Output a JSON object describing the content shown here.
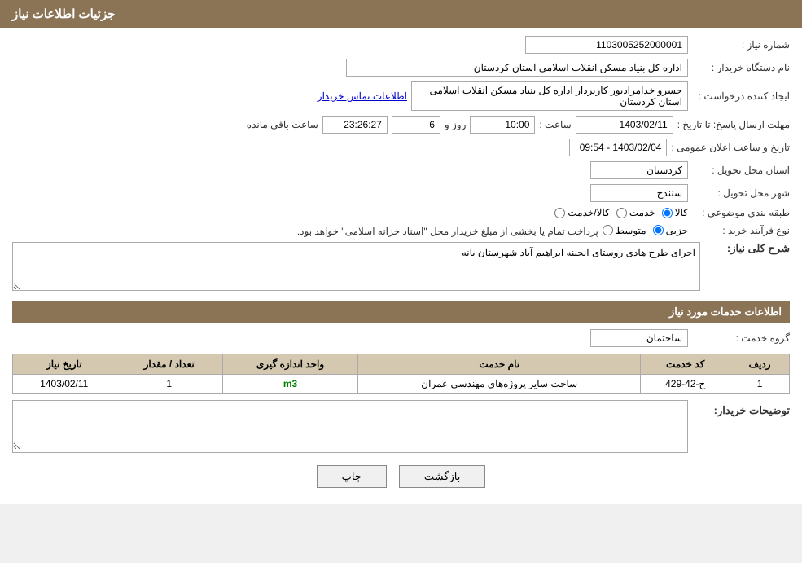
{
  "page": {
    "title": "جزئیات اطلاعات نیاز",
    "header": "جزئیات اطلاعات نیاز"
  },
  "fields": {
    "need_number_label": "شماره نیاز :",
    "need_number_value": "1103005252000001",
    "buyer_org_label": "نام دستگاه خریدار :",
    "buyer_org_value": "اداره کل بنیاد مسکن انقلاب اسلامی استان کردستان",
    "creator_label": "ایجاد کننده درخواست :",
    "creator_value": "جسرو خدامرادیور کاربردار اداره کل بنیاد مسکن انقلاب اسلامی استان کردستان",
    "creator_link": "اطلاعات تماس خریدار",
    "deadline_label": "مهلت ارسال پاسخ: تا تاریخ :",
    "date_value": "1403/02/11",
    "time_label": "ساعت :",
    "time_value": "10:00",
    "day_label": "روز و",
    "day_value": "6",
    "remaining_label": "ساعت باقی مانده",
    "remaining_value": "23:26:27",
    "announce_label": "تاریخ و ساعت اعلان عمومی :",
    "announce_value": "1403/02/04 - 09:54",
    "province_label": "استان محل تحویل :",
    "province_value": "کردستان",
    "city_label": "شهر محل تحویل :",
    "city_value": "سنندج",
    "category_label": "طبقه بندی موضوعی :",
    "radio_kala": "کالا",
    "radio_khadamat": "خدمت",
    "radio_kala_khadamat": "کالا/خدمت",
    "process_label": "نوع فرآیند خرید :",
    "radio_jozvi": "جزیی",
    "radio_motovaset": "متوسط",
    "payment_text": "پرداخت تمام یا بخشی از مبلغ خریدار محل \"اسناد خزانه اسلامی\" خواهد بود.",
    "description_label": "شرح کلی نیاز:",
    "description_value": "اجرای طرح هادی روستای انجینه ابراهیم آباد شهرستان بانه",
    "services_title": "اطلاعات خدمات مورد نیاز",
    "service_group_label": "گروه خدمت :",
    "service_group_value": "ساختمان",
    "table": {
      "headers": [
        "ردیف",
        "کد خدمت",
        "نام خدمت",
        "واحد اندازه گیری",
        "تعداد / مقدار",
        "تاریخ نیاز"
      ],
      "rows": [
        {
          "row": "1",
          "code": "ج-42-429",
          "name": "ساخت سایر پروژه‌های مهندسی عمران",
          "unit": "m3",
          "count": "1",
          "date": "1403/02/11"
        }
      ]
    },
    "buyer_notes_label": "توضیحات خریدار:",
    "btn_back": "بازگشت",
    "btn_print": "چاپ"
  }
}
